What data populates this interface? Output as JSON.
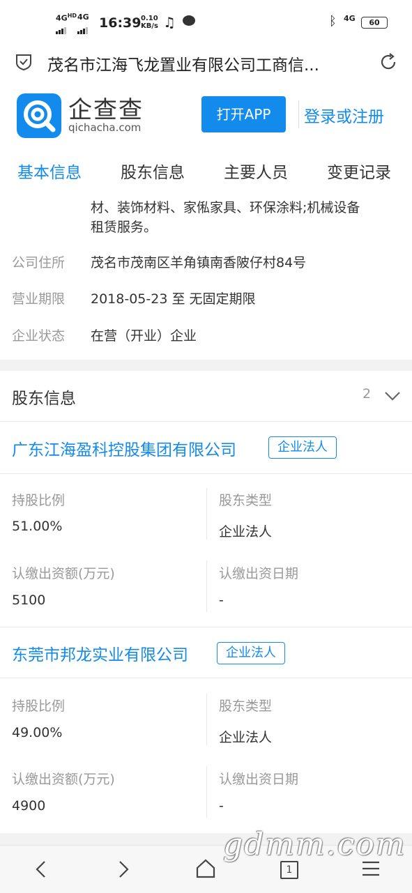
{
  "status_bar": {
    "network1": "4G",
    "network1_sup": "HD",
    "network2": "4G",
    "time": "16:39",
    "speed_value": "0.10",
    "speed_unit": "KB/s",
    "network3": "4G",
    "battery": "60"
  },
  "browser": {
    "title": "茂名市江海飞龙置业有限公司工商信..."
  },
  "header": {
    "logo_cn": "企查查",
    "logo_en": "qichacha.com",
    "open_app": "打开APP",
    "login": "登录或注册"
  },
  "tabs": [
    "基本信息",
    "股东信息",
    "主要人员",
    "变更记录"
  ],
  "basic_info": {
    "scope_line1": "材、装饰材料、家俬家具、环保涂料;机械设备",
    "scope_line2": "租赁服务。",
    "rows": [
      {
        "label": "公司住所",
        "value": "茂名市茂南区羊角镇南香陂仔村84号"
      },
      {
        "label": "营业期限",
        "value": "2018-05-23 至 无固定期限"
      },
      {
        "label": "企业状态",
        "value": "在营（开业）企业"
      }
    ]
  },
  "shareholders": {
    "title": "股东信息",
    "count": "2",
    "items": [
      {
        "name": "广东江海盈科控股集团有限公司",
        "badge": "企业法人",
        "ratio_label": "持股比例",
        "ratio": "51.00%",
        "type_label": "股东类型",
        "type": "企业法人",
        "amount_label": "认缴出资额(万元)",
        "amount": "5100",
        "date_label": "认缴出资日期",
        "date": "-"
      },
      {
        "name": "东莞市邦龙实业有限公司",
        "badge": "企业法人",
        "ratio_label": "持股比例",
        "ratio": "49.00%",
        "type_label": "股东类型",
        "type": "企业法人",
        "amount_label": "认缴出资额(万元)",
        "amount": "4900",
        "date_label": "认缴出资日期",
        "date": "-"
      }
    ]
  },
  "bottom_nav": {
    "tab_count": "1"
  },
  "watermark": "gdmm.com",
  "colors": {
    "accent": "#128bed",
    "background": "#f2f2f2"
  }
}
